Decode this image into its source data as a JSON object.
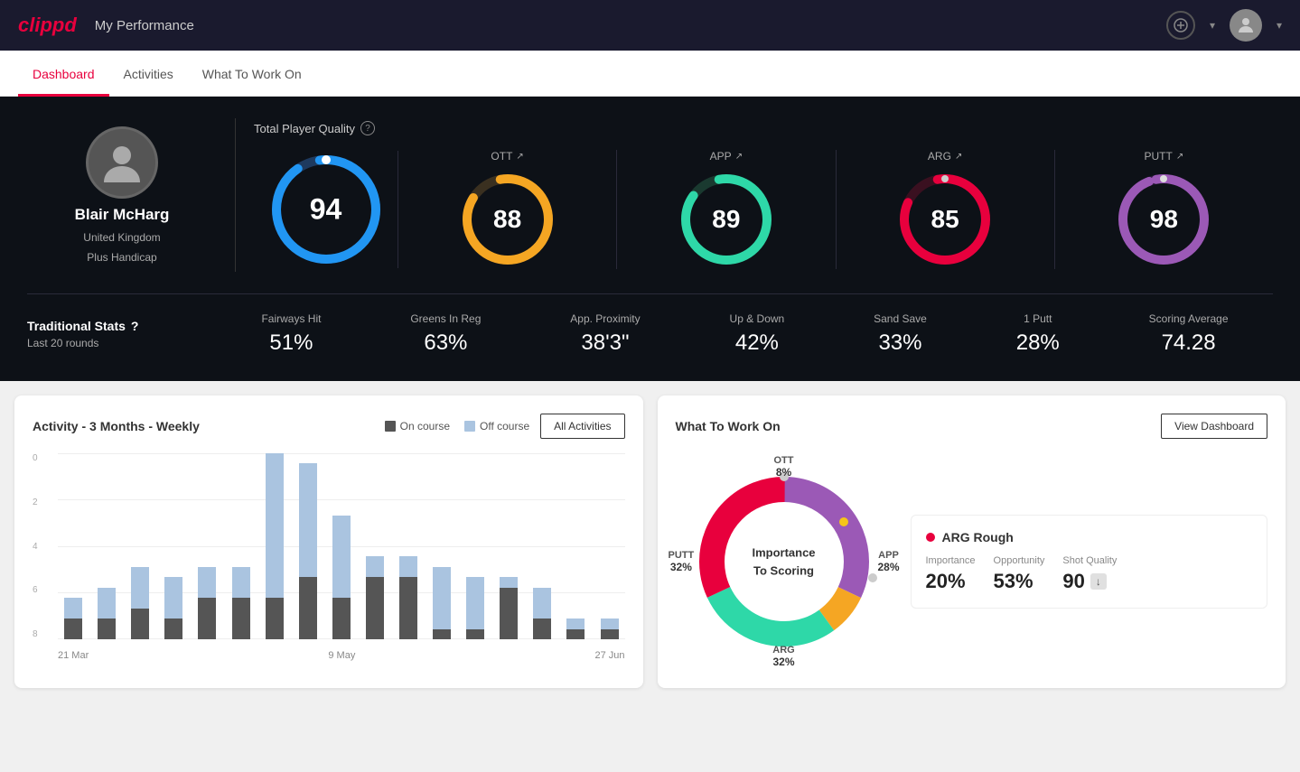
{
  "app": {
    "logo": "clippd",
    "header_title": "My Performance"
  },
  "nav": {
    "tabs": [
      {
        "id": "dashboard",
        "label": "Dashboard",
        "active": true
      },
      {
        "id": "activities",
        "label": "Activities",
        "active": false
      },
      {
        "id": "what-to-work-on",
        "label": "What To Work On",
        "active": false
      }
    ]
  },
  "player": {
    "name": "Blair McHarg",
    "country": "United Kingdom",
    "handicap": "Plus Handicap"
  },
  "quality": {
    "section_label": "Total Player Quality",
    "main": {
      "value": "94"
    },
    "categories": [
      {
        "id": "ott",
        "label": "OTT",
        "value": "88",
        "color": "#f5a623",
        "track_color": "#3a3020"
      },
      {
        "id": "app",
        "label": "APP",
        "value": "89",
        "color": "#2ed8a8",
        "track_color": "#1a3a30"
      },
      {
        "id": "arg",
        "label": "ARG",
        "value": "85",
        "color": "#e8003d",
        "track_color": "#3a1020"
      },
      {
        "id": "putt",
        "label": "PUTT",
        "value": "98",
        "color": "#9b59b6",
        "track_color": "#2a1a3a"
      }
    ]
  },
  "traditional_stats": {
    "title": "Traditional Stats",
    "subtitle": "Last 20 rounds",
    "items": [
      {
        "label": "Fairways Hit",
        "value": "51%"
      },
      {
        "label": "Greens In Reg",
        "value": "63%"
      },
      {
        "label": "App. Proximity",
        "value": "38'3\""
      },
      {
        "label": "Up & Down",
        "value": "42%"
      },
      {
        "label": "Sand Save",
        "value": "33%"
      },
      {
        "label": "1 Putt",
        "value": "28%"
      },
      {
        "label": "Scoring Average",
        "value": "74.28"
      }
    ]
  },
  "activity_chart": {
    "title": "Activity - 3 Months - Weekly",
    "legend": {
      "on_course": "On course",
      "off_course": "Off course"
    },
    "all_activities_btn": "All Activities",
    "y_labels": [
      "0",
      "2",
      "4",
      "6",
      "8"
    ],
    "x_labels": [
      "21 Mar",
      "9 May",
      "27 Jun"
    ],
    "bars": [
      {
        "on": 1,
        "off": 1
      },
      {
        "on": 1,
        "off": 1.5
      },
      {
        "on": 1.5,
        "off": 2
      },
      {
        "on": 1,
        "off": 2
      },
      {
        "on": 2,
        "off": 1.5
      },
      {
        "on": 2,
        "off": 1.5
      },
      {
        "on": 2,
        "off": 7
      },
      {
        "on": 3,
        "off": 5.5
      },
      {
        "on": 2,
        "off": 4
      },
      {
        "on": 3,
        "off": 1
      },
      {
        "on": 3,
        "off": 1
      },
      {
        "on": 0.5,
        "off": 3
      },
      {
        "on": 0.5,
        "off": 2.5
      },
      {
        "on": 2.5,
        "off": 0.5
      },
      {
        "on": 1,
        "off": 1.5
      },
      {
        "on": 0.5,
        "off": 0.5
      },
      {
        "on": 0.5,
        "off": 0.5
      }
    ]
  },
  "what_to_work_on": {
    "title": "What To Work On",
    "view_dashboard_btn": "View Dashboard",
    "donut_center": "Importance\nTo Scoring",
    "segments": [
      {
        "label": "OTT",
        "percent": "8%",
        "color": "#f5a623",
        "value": 8
      },
      {
        "label": "APP",
        "percent": "28%",
        "color": "#2ed8a8",
        "value": 28
      },
      {
        "label": "ARG",
        "percent": "32%",
        "color": "#e8003d",
        "value": 32
      },
      {
        "label": "PUTT",
        "percent": "32%",
        "color": "#9b59b6",
        "value": 32
      }
    ],
    "info_card": {
      "title": "ARG Rough",
      "importance_label": "Importance",
      "importance_value": "20%",
      "opportunity_label": "Opportunity",
      "opportunity_value": "53%",
      "shot_quality_label": "Shot Quality",
      "shot_quality_value": "90"
    }
  }
}
